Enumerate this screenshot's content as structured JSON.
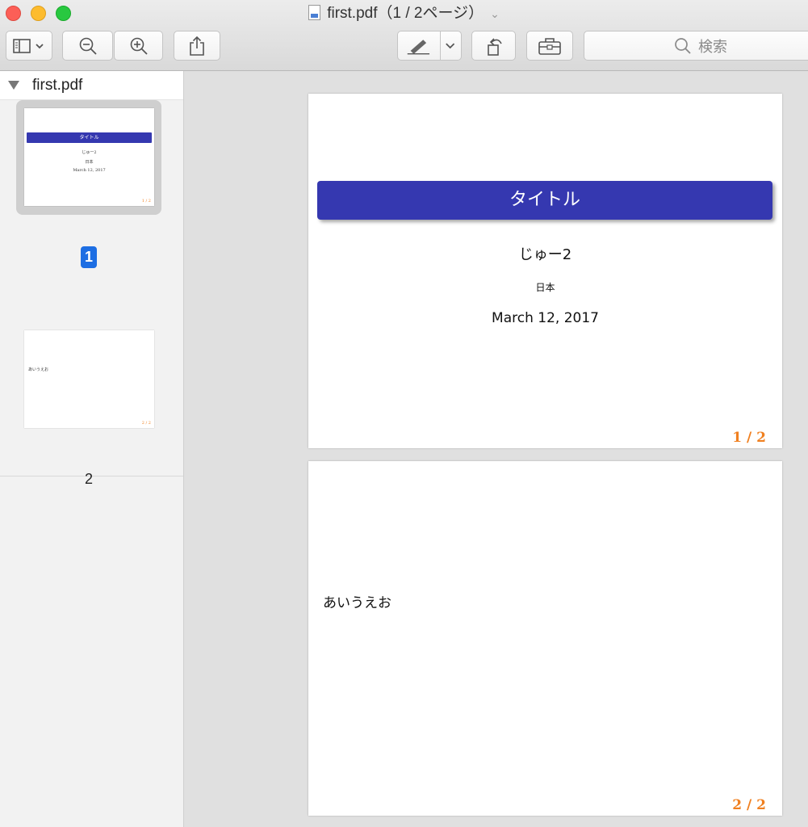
{
  "window": {
    "title": "first.pdf（1 / 2ページ）"
  },
  "toolbar": {
    "search_placeholder": "検索"
  },
  "sidebar": {
    "file_name": "first.pdf",
    "pages": [
      {
        "number": "1",
        "selected": true
      },
      {
        "number": "2",
        "selected": false
      }
    ]
  },
  "document": {
    "page1": {
      "title": "タイトル",
      "author": "じゅー2",
      "institute": "日本",
      "date": "March 12, 2017",
      "page_number": "1 / 2"
    },
    "page2": {
      "body": "あいうえお",
      "page_number": "2 / 2"
    }
  },
  "colors": {
    "title_bar": "#3538b0",
    "page_number": "#f08020",
    "selection_badge": "#1d6ee3"
  }
}
